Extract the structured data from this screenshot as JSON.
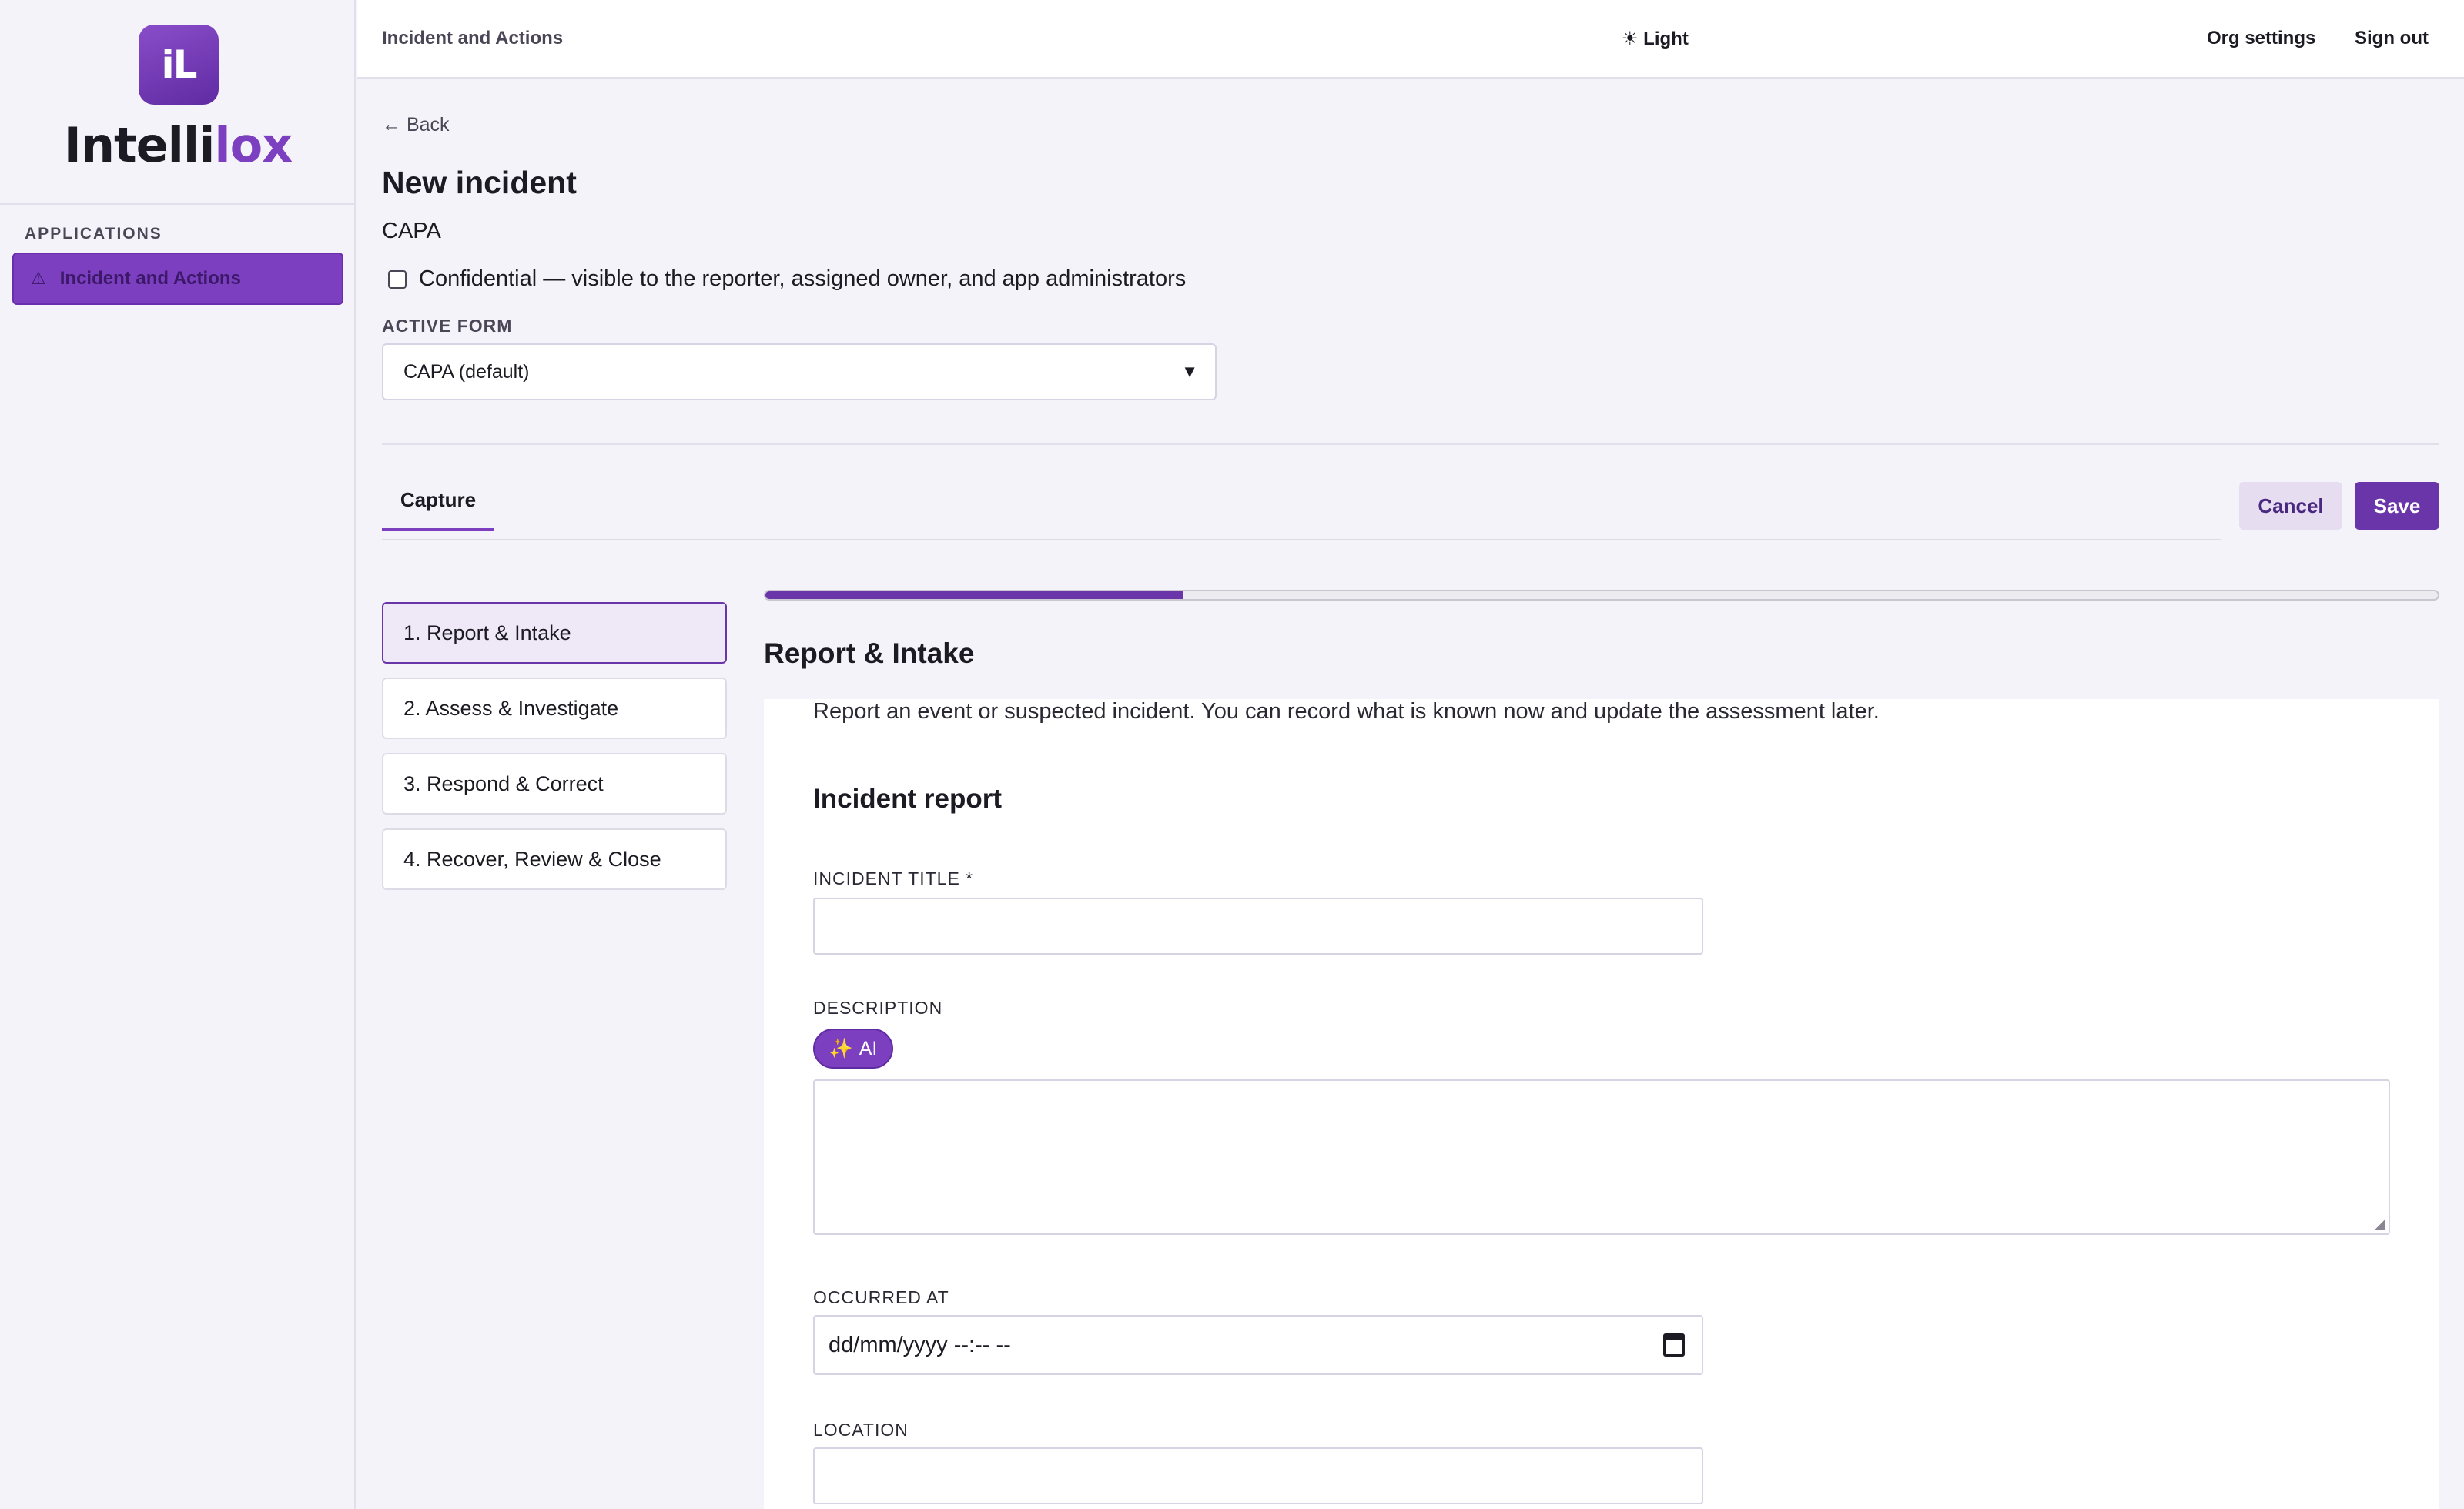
{
  "brand": {
    "logo_mark": "iL",
    "name_main": "Intelli",
    "name_accent": "lox",
    "accent_color": "#7c3fbf"
  },
  "sidebar": {
    "section_label": "APPLICATIONS",
    "items": [
      {
        "label": "Incident and Actions",
        "icon": "warning-triangle-icon",
        "active": true
      }
    ]
  },
  "topbar": {
    "title": "Incident and Actions",
    "theme_toggle": "☀ Light",
    "org_settings": "Org settings",
    "sign_out": "Sign out"
  },
  "page": {
    "back": "← Back",
    "title": "New incident",
    "app_type": "CAPA",
    "confidential_label": "Confidential — visible to the reporter, assigned owner, and app administrators",
    "confidential_checked": false,
    "active_form_label": "ACTIVE FORM",
    "active_form_value": "CAPA (default)"
  },
  "tabs": [
    {
      "label": "Capture",
      "active": true
    }
  ],
  "actions": {
    "cancel": "Cancel",
    "save": "Save"
  },
  "steps": [
    {
      "label": "1. Report & Intake",
      "active": true
    },
    {
      "label": "2. Assess & Investigate",
      "active": false
    },
    {
      "label": "3. Respond & Correct",
      "active": false
    },
    {
      "label": "4. Recover, Review & Close",
      "active": false
    }
  ],
  "progress": {
    "fraction": 0.25
  },
  "section": {
    "title": "Report & Intake",
    "description": "Report an event or suspected incident. You can record what is known now and update the assessment later.",
    "subtitle": "Incident report"
  },
  "fields": {
    "incident_title": {
      "label": "INCIDENT TITLE *",
      "value": ""
    },
    "description": {
      "label": "DESCRIPTION",
      "ai_button": "AI",
      "ai_icon": "sparkles-icon",
      "value": ""
    },
    "occurred_at": {
      "label": "OCCURRED AT",
      "placeholder": "dd/mm/yyyy --:-- --"
    },
    "location": {
      "label": "LOCATION",
      "value": ""
    }
  }
}
